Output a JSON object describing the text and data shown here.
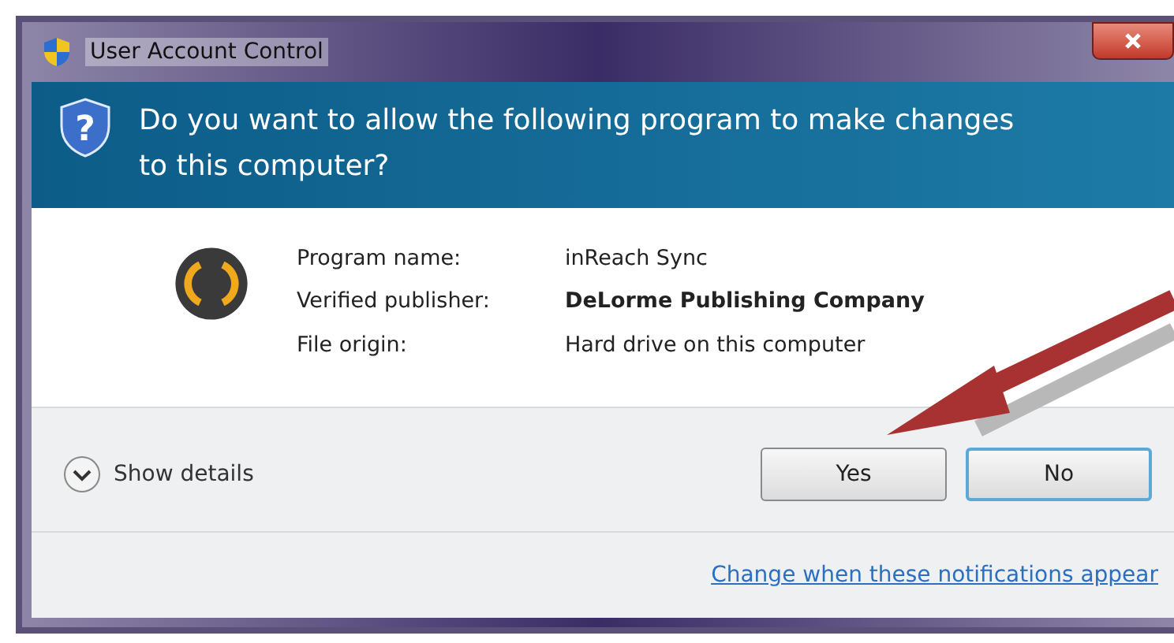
{
  "window": {
    "title": "User Account Control"
  },
  "header": {
    "icon_glyph": "?",
    "question": "Do you want to allow the following program to make changes to this computer?"
  },
  "details": [
    {
      "label": "Program name:",
      "value": "inReach Sync",
      "bold": false
    },
    {
      "label": "Verified publisher:",
      "value": "DeLorme Publishing Company",
      "bold": true
    },
    {
      "label": "File origin:",
      "value": "Hard drive on this computer",
      "bold": false
    }
  ],
  "show_details": {
    "label": "Show details",
    "expanded": false
  },
  "buttons": [
    {
      "label": "Yes",
      "selected": false
    },
    {
      "label": "No",
      "selected": true
    }
  ],
  "footer_link": "Change when these notifications appear"
}
